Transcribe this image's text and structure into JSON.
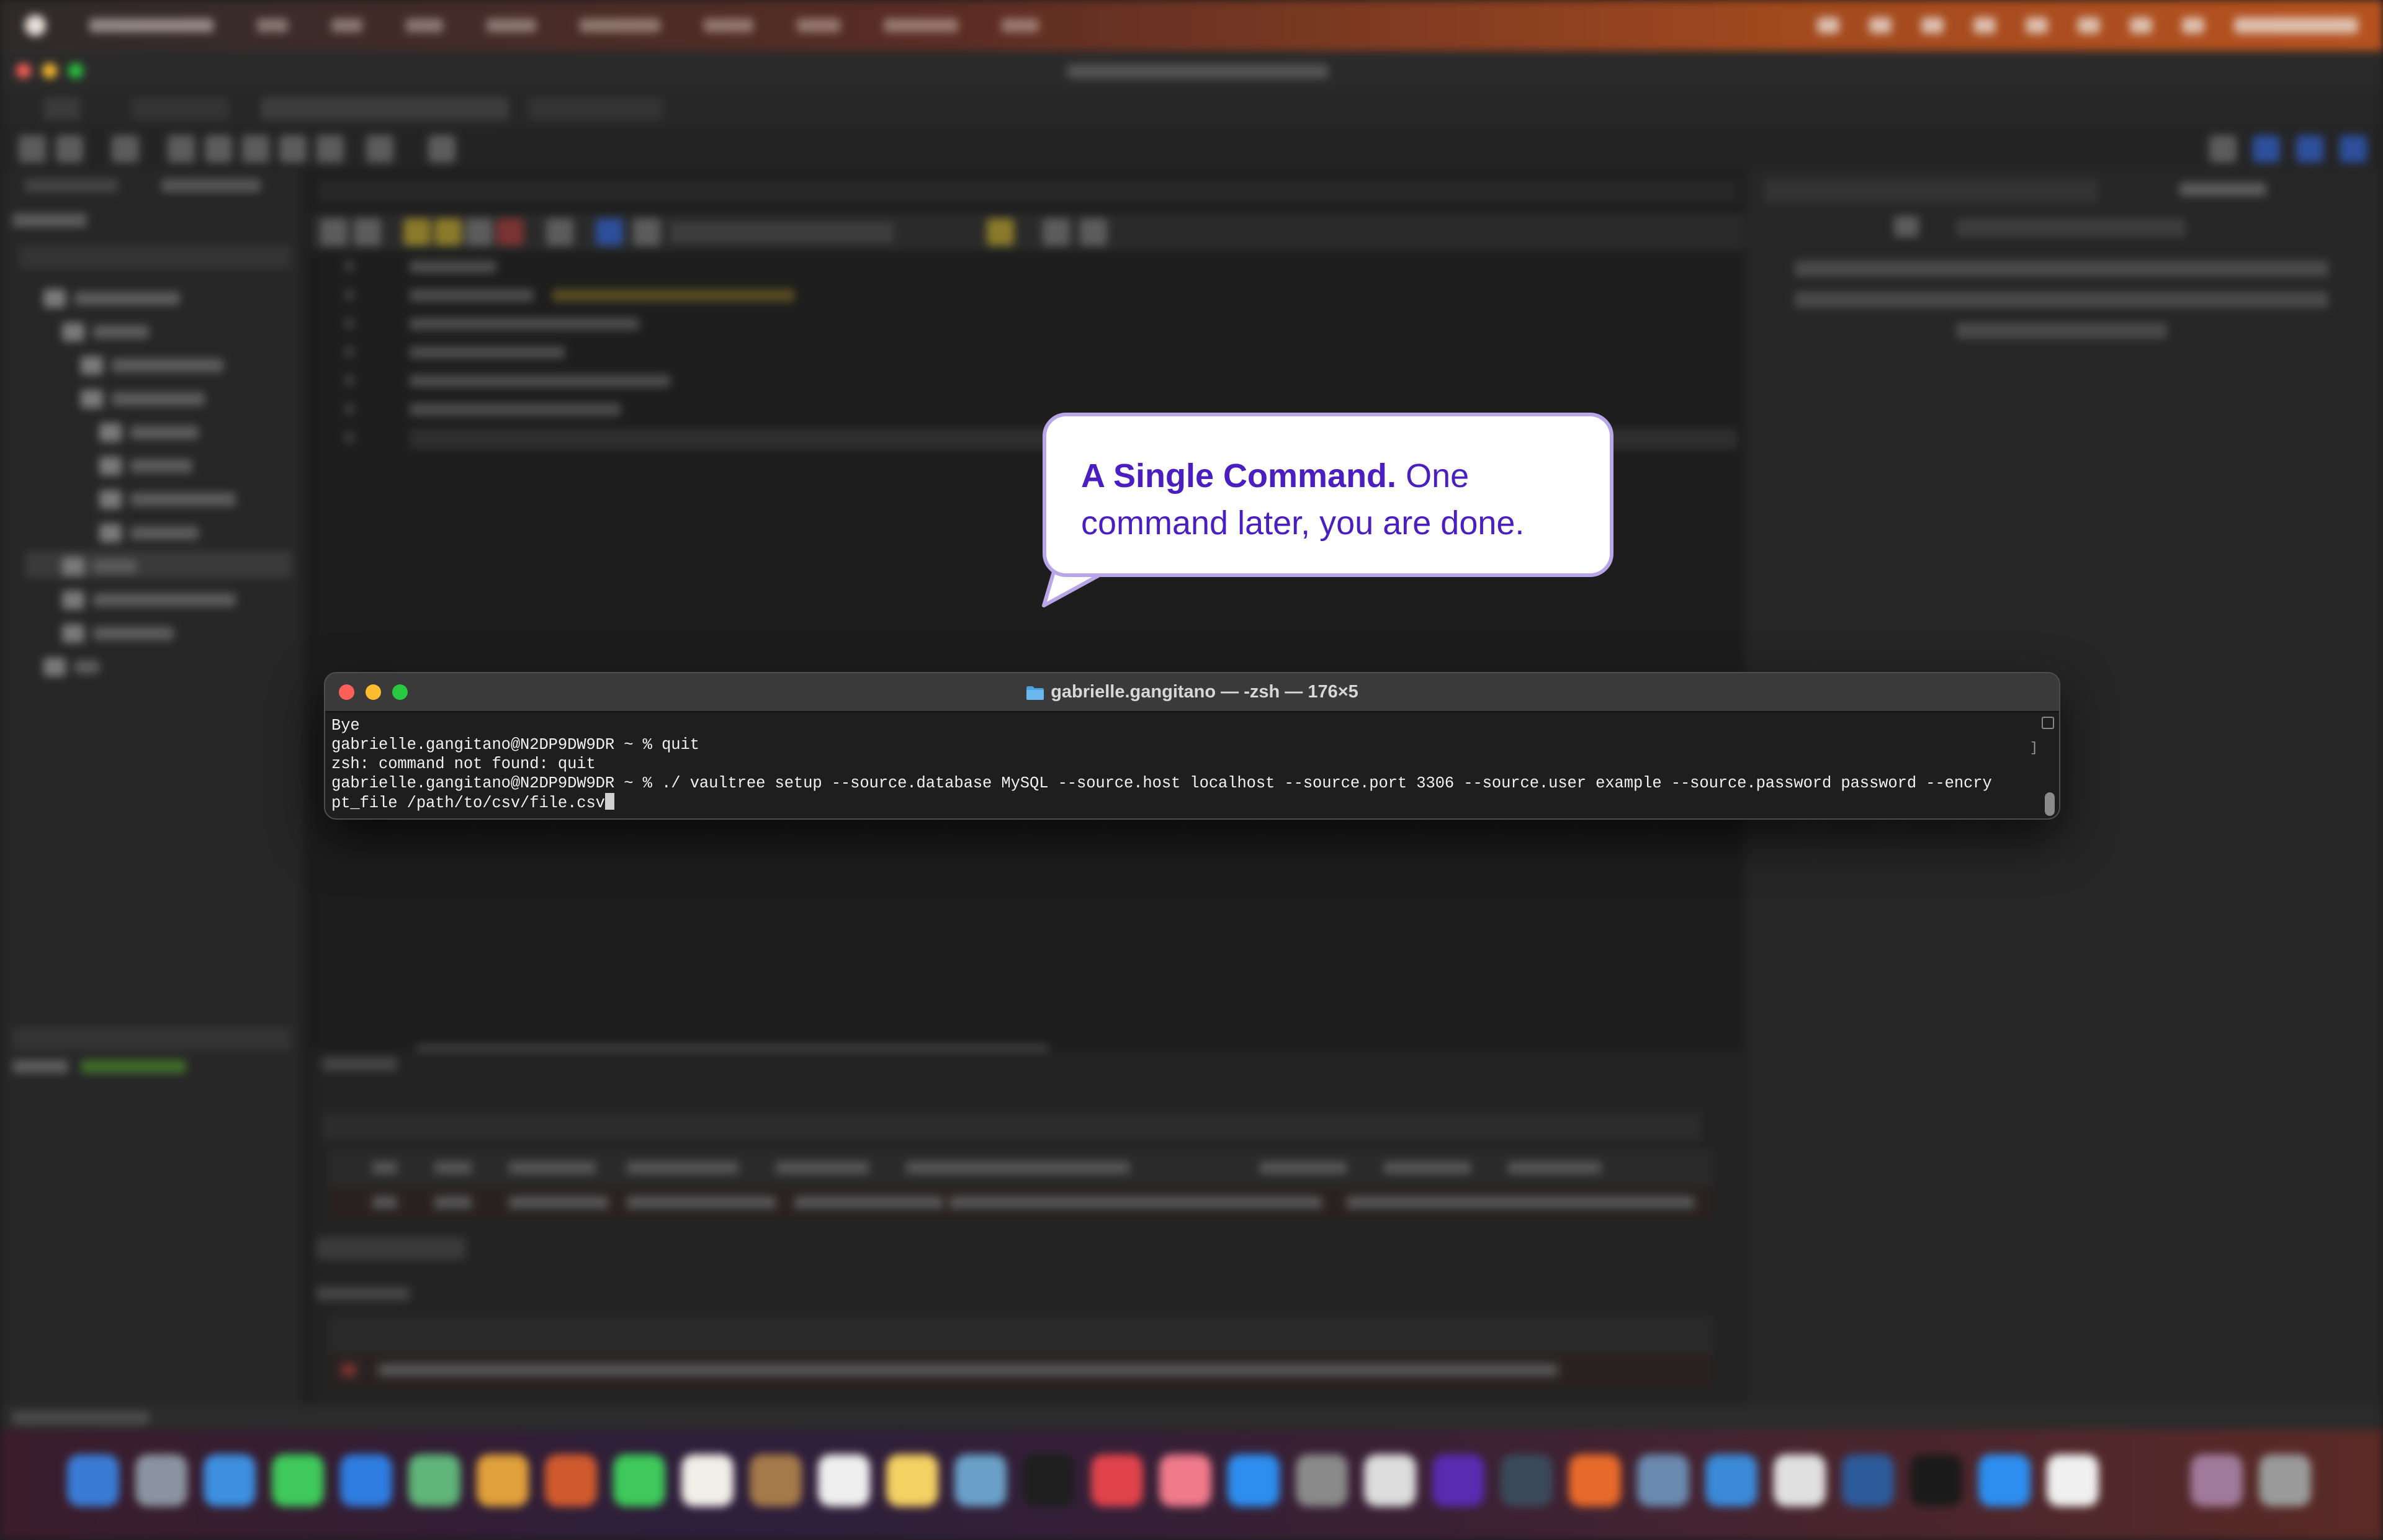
{
  "callout": {
    "title": "A Single Command.",
    "text_line1": "One",
    "text_line2": "command later, you are done."
  },
  "terminal": {
    "window_title": "gabrielle.gangitano — -zsh — 176×5",
    "lines": [
      "Bye",
      "gabrielle.gangitano@N2DP9DW9DR ~ % quit",
      "zsh: command not found: quit",
      "gabrielle.gangitano@N2DP9DW9DR ~ % ./ vaultree setup --source.database MySQL --source.host localhost --source.port 3306 --source.user example --source.password password --encry",
      "pt_file /path/to/csv/file.csv"
    ]
  },
  "colors": {
    "callout_text": "#4a1ec0",
    "callout_border": "#b9a6e8",
    "close": "#fe5f57",
    "minimize": "#febc2e",
    "maximize": "#28c840",
    "folder": "#4aa3df"
  },
  "icons": [
    "folder-icon"
  ]
}
